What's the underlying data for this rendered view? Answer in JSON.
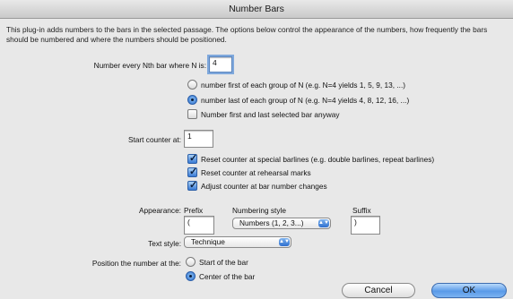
{
  "window": {
    "title": "Number Bars"
  },
  "intro": "This plug-in adds numbers to the bars in the selected passage. The options below control the appearance of the numbers, how frequently the bars should be numbered and where the numbers should be positioned.",
  "every_n": {
    "label": "Number every Nth bar where N is:",
    "value": "4"
  },
  "group_options": [
    {
      "label": "number first of each group of N (e.g. N=4 yields 1, 5, 9, 13, ...)",
      "selected": false
    },
    {
      "label": "number last of each group of N (e.g. N=4 yields 4, 8, 12, 16, ...)",
      "selected": true
    }
  ],
  "number_first_last": {
    "label": "Number first and last selected bar anyway",
    "checked": false
  },
  "start_counter": {
    "label": "Start counter at:",
    "value": "1"
  },
  "reset_options": [
    {
      "label": "Reset counter at special barlines (e.g. double barlines, repeat barlines)",
      "checked": true
    },
    {
      "label": "Reset counter at rehearsal marks",
      "checked": true
    },
    {
      "label": "Adjust counter at bar number changes",
      "checked": true
    }
  ],
  "appearance": {
    "label": "Appearance:",
    "prefix_label": "Prefix",
    "prefix_value": "(",
    "style_label": "Numbering style",
    "style_value": "Numbers (1, 2, 3...)",
    "suffix_label": "Suffix",
    "suffix_value": ")"
  },
  "text_style": {
    "label": "Text style:",
    "value": "Technique"
  },
  "position": {
    "label": "Position the number at the:",
    "options": [
      {
        "label": "Start of the bar",
        "selected": false
      },
      {
        "label": "Center of the bar",
        "selected": true
      }
    ]
  },
  "buttons": {
    "cancel": "Cancel",
    "ok": "OK"
  },
  "colors": {
    "accent": "#3a7bd5",
    "background": "#e8e8e8"
  }
}
